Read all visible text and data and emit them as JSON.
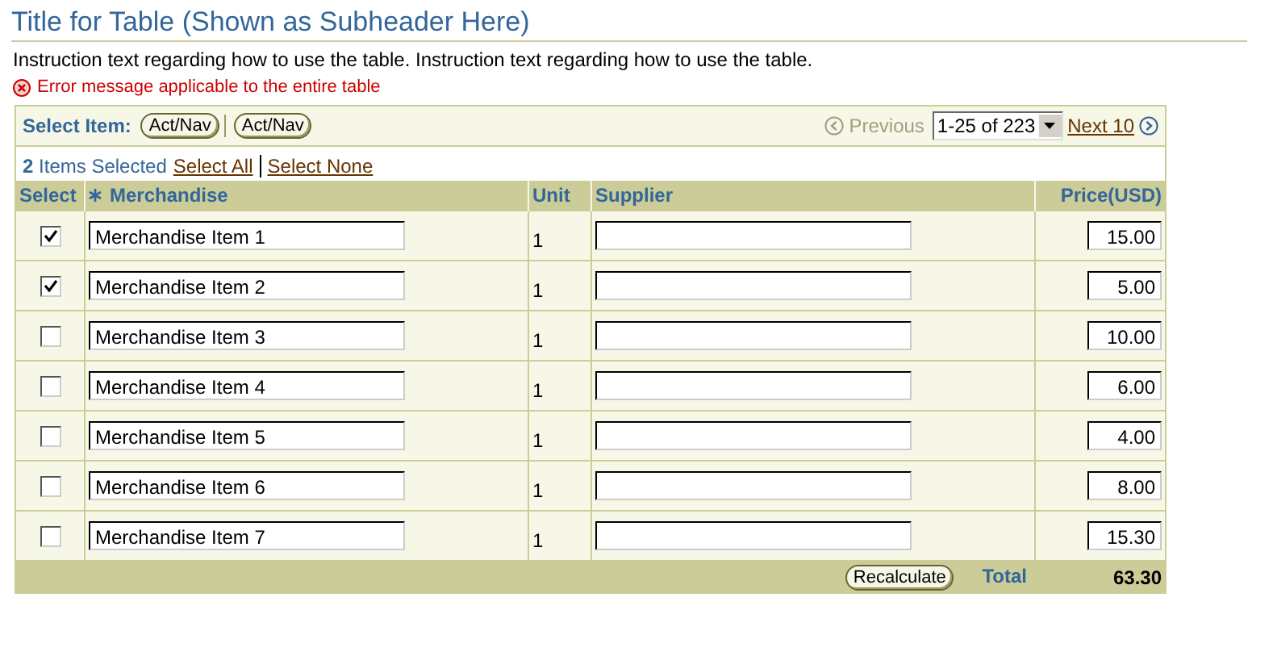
{
  "title": "Title for Table (Shown as Subheader Here)",
  "instruction": "Instruction text regarding how to use the table. Instruction text regarding how to use the table.",
  "error": "Error message applicable to the entire table",
  "controls": {
    "label": "Select Item:",
    "buttons": [
      "Act/Nav",
      "Act/Nav"
    ],
    "previous": {
      "label": "Previous",
      "disabled": true
    },
    "range": {
      "value": "1-25 of 223"
    },
    "next": {
      "label": "Next 10",
      "disabled": false
    }
  },
  "selection": {
    "summary": "**2** Items Selected",
    "links": [
      "Select All",
      "Select None"
    ]
  },
  "table": {
    "columns": [
      {
        "label": "Select",
        "required": false
      },
      {
        "label": "Merchandise",
        "required": true
      },
      {
        "label": "Unit",
        "required": false
      },
      {
        "label": "Supplier",
        "required": false
      },
      {
        "label": "Price(USD)",
        "required": false
      }
    ],
    "rows": [
      {
        "checked": true,
        "merchandise": "Merchandise Item 1",
        "unit": "1",
        "price": "15.00"
      },
      {
        "checked": true,
        "merchandise": "Merchandise Item 2",
        "unit": "1",
        "price": "5.00"
      },
      {
        "checked": false,
        "merchandise": "Merchandise Item 3",
        "unit": "1",
        "price": "10.00"
      },
      {
        "checked": false,
        "merchandise": "Merchandise Item 4",
        "unit": "1",
        "price": "6.00"
      },
      {
        "checked": false,
        "merchandise": "Merchandise Item 5",
        "unit": "1",
        "price": "4.00"
      },
      {
        "checked": false,
        "merchandise": "Merchandise Item 6",
        "unit": "1",
        "price": "8.00"
      },
      {
        "checked": false,
        "merchandise": "Merchandise Item 7",
        "unit": "1",
        "price": "15.30"
      }
    ],
    "footer": {
      "button": "Recalculate",
      "total_label": "Total",
      "total": "63.30"
    }
  }
}
